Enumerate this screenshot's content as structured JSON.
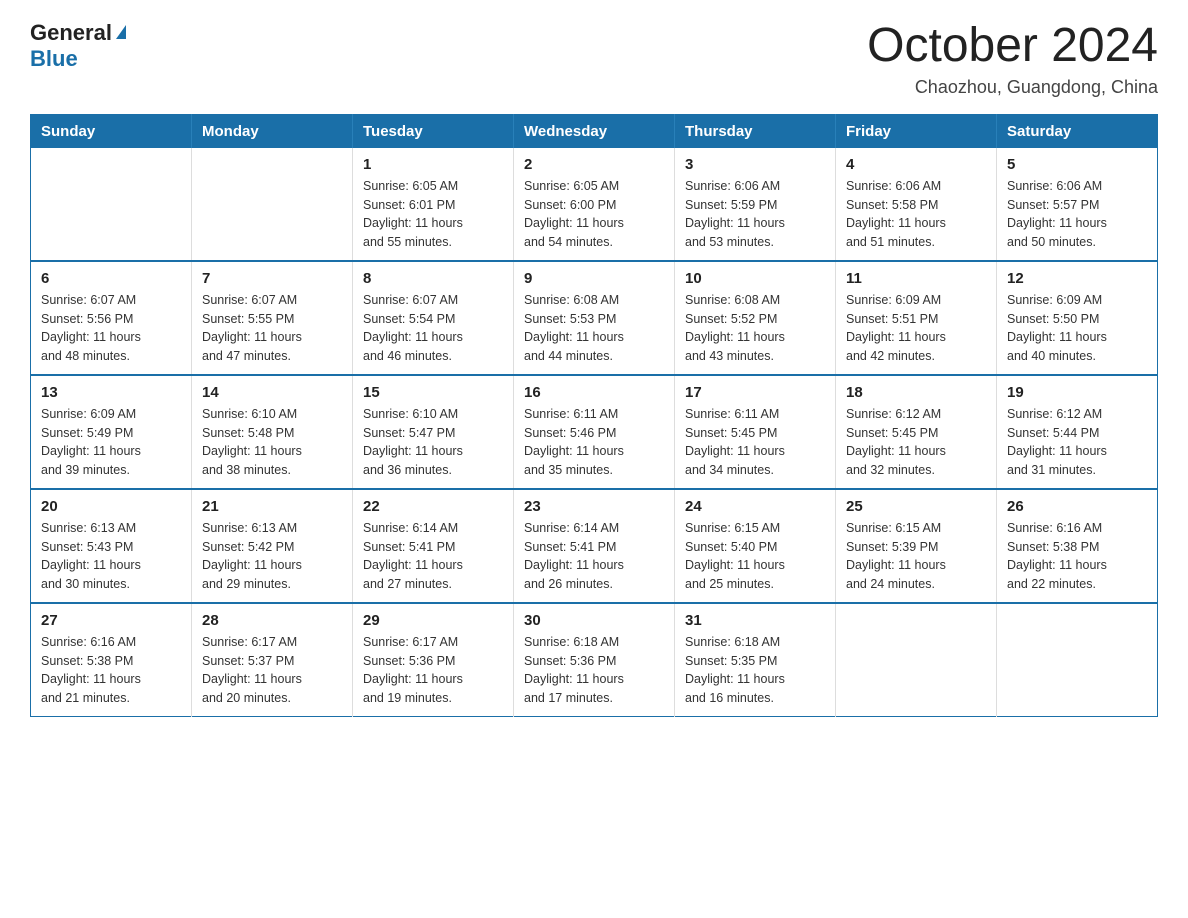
{
  "logo": {
    "general": "General",
    "blue": "Blue",
    "arrow": "▶"
  },
  "title": "October 2024",
  "subtitle": "Chaozhou, Guangdong, China",
  "days_of_week": [
    "Sunday",
    "Monday",
    "Tuesday",
    "Wednesday",
    "Thursday",
    "Friday",
    "Saturday"
  ],
  "weeks": [
    [
      {
        "day": "",
        "info": ""
      },
      {
        "day": "",
        "info": ""
      },
      {
        "day": "1",
        "info": "Sunrise: 6:05 AM\nSunset: 6:01 PM\nDaylight: 11 hours\nand 55 minutes."
      },
      {
        "day": "2",
        "info": "Sunrise: 6:05 AM\nSunset: 6:00 PM\nDaylight: 11 hours\nand 54 minutes."
      },
      {
        "day": "3",
        "info": "Sunrise: 6:06 AM\nSunset: 5:59 PM\nDaylight: 11 hours\nand 53 minutes."
      },
      {
        "day": "4",
        "info": "Sunrise: 6:06 AM\nSunset: 5:58 PM\nDaylight: 11 hours\nand 51 minutes."
      },
      {
        "day": "5",
        "info": "Sunrise: 6:06 AM\nSunset: 5:57 PM\nDaylight: 11 hours\nand 50 minutes."
      }
    ],
    [
      {
        "day": "6",
        "info": "Sunrise: 6:07 AM\nSunset: 5:56 PM\nDaylight: 11 hours\nand 48 minutes."
      },
      {
        "day": "7",
        "info": "Sunrise: 6:07 AM\nSunset: 5:55 PM\nDaylight: 11 hours\nand 47 minutes."
      },
      {
        "day": "8",
        "info": "Sunrise: 6:07 AM\nSunset: 5:54 PM\nDaylight: 11 hours\nand 46 minutes."
      },
      {
        "day": "9",
        "info": "Sunrise: 6:08 AM\nSunset: 5:53 PM\nDaylight: 11 hours\nand 44 minutes."
      },
      {
        "day": "10",
        "info": "Sunrise: 6:08 AM\nSunset: 5:52 PM\nDaylight: 11 hours\nand 43 minutes."
      },
      {
        "day": "11",
        "info": "Sunrise: 6:09 AM\nSunset: 5:51 PM\nDaylight: 11 hours\nand 42 minutes."
      },
      {
        "day": "12",
        "info": "Sunrise: 6:09 AM\nSunset: 5:50 PM\nDaylight: 11 hours\nand 40 minutes."
      }
    ],
    [
      {
        "day": "13",
        "info": "Sunrise: 6:09 AM\nSunset: 5:49 PM\nDaylight: 11 hours\nand 39 minutes."
      },
      {
        "day": "14",
        "info": "Sunrise: 6:10 AM\nSunset: 5:48 PM\nDaylight: 11 hours\nand 38 minutes."
      },
      {
        "day": "15",
        "info": "Sunrise: 6:10 AM\nSunset: 5:47 PM\nDaylight: 11 hours\nand 36 minutes."
      },
      {
        "day": "16",
        "info": "Sunrise: 6:11 AM\nSunset: 5:46 PM\nDaylight: 11 hours\nand 35 minutes."
      },
      {
        "day": "17",
        "info": "Sunrise: 6:11 AM\nSunset: 5:45 PM\nDaylight: 11 hours\nand 34 minutes."
      },
      {
        "day": "18",
        "info": "Sunrise: 6:12 AM\nSunset: 5:45 PM\nDaylight: 11 hours\nand 32 minutes."
      },
      {
        "day": "19",
        "info": "Sunrise: 6:12 AM\nSunset: 5:44 PM\nDaylight: 11 hours\nand 31 minutes."
      }
    ],
    [
      {
        "day": "20",
        "info": "Sunrise: 6:13 AM\nSunset: 5:43 PM\nDaylight: 11 hours\nand 30 minutes."
      },
      {
        "day": "21",
        "info": "Sunrise: 6:13 AM\nSunset: 5:42 PM\nDaylight: 11 hours\nand 29 minutes."
      },
      {
        "day": "22",
        "info": "Sunrise: 6:14 AM\nSunset: 5:41 PM\nDaylight: 11 hours\nand 27 minutes."
      },
      {
        "day": "23",
        "info": "Sunrise: 6:14 AM\nSunset: 5:41 PM\nDaylight: 11 hours\nand 26 minutes."
      },
      {
        "day": "24",
        "info": "Sunrise: 6:15 AM\nSunset: 5:40 PM\nDaylight: 11 hours\nand 25 minutes."
      },
      {
        "day": "25",
        "info": "Sunrise: 6:15 AM\nSunset: 5:39 PM\nDaylight: 11 hours\nand 24 minutes."
      },
      {
        "day": "26",
        "info": "Sunrise: 6:16 AM\nSunset: 5:38 PM\nDaylight: 11 hours\nand 22 minutes."
      }
    ],
    [
      {
        "day": "27",
        "info": "Sunrise: 6:16 AM\nSunset: 5:38 PM\nDaylight: 11 hours\nand 21 minutes."
      },
      {
        "day": "28",
        "info": "Sunrise: 6:17 AM\nSunset: 5:37 PM\nDaylight: 11 hours\nand 20 minutes."
      },
      {
        "day": "29",
        "info": "Sunrise: 6:17 AM\nSunset: 5:36 PM\nDaylight: 11 hours\nand 19 minutes."
      },
      {
        "day": "30",
        "info": "Sunrise: 6:18 AM\nSunset: 5:36 PM\nDaylight: 11 hours\nand 17 minutes."
      },
      {
        "day": "31",
        "info": "Sunrise: 6:18 AM\nSunset: 5:35 PM\nDaylight: 11 hours\nand 16 minutes."
      },
      {
        "day": "",
        "info": ""
      },
      {
        "day": "",
        "info": ""
      }
    ]
  ]
}
